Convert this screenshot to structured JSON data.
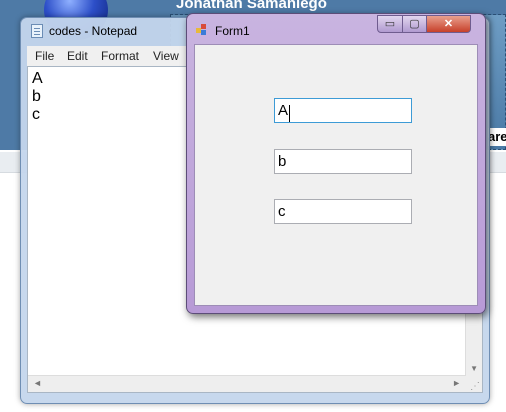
{
  "background_app": {
    "title": "Jonathan Samaniego",
    "side_label": "are"
  },
  "notepad": {
    "title": "codes - Notepad",
    "menu": [
      "File",
      "Edit",
      "Format",
      "View"
    ],
    "lines": [
      "A",
      "b",
      "c"
    ]
  },
  "form1": {
    "title": "Form1",
    "min_glyph": "▭",
    "max_glyph": "▢",
    "close_glyph": "✕",
    "inputs": [
      {
        "value": "A"
      },
      {
        "value": "b"
      },
      {
        "value": "c"
      }
    ]
  },
  "colors": {
    "focus_border": "#3d9bd6",
    "close_button": "#c7402a"
  }
}
